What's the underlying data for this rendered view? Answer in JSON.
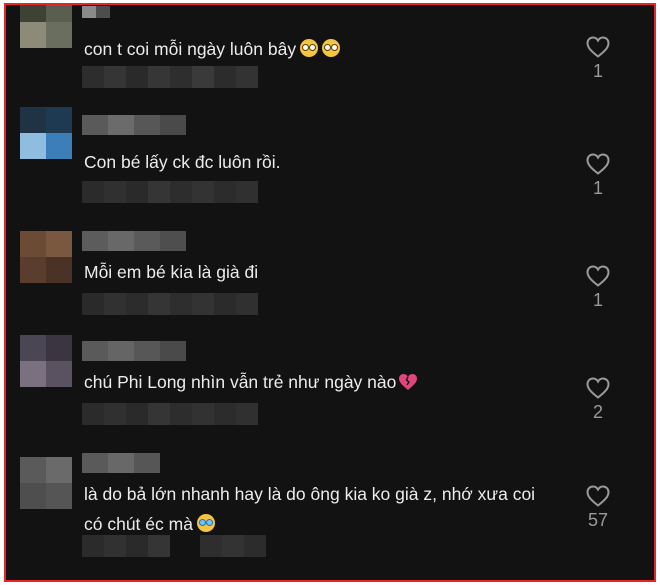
{
  "comments": [
    {
      "text": "con t coi mỗi ngày luôn bây",
      "likes": "1",
      "emoji": [
        "flushed-emoji",
        "flushed-emoji"
      ]
    },
    {
      "text": "Con bé lấy ck đc luôn rồi.",
      "likes": "1"
    },
    {
      "text": "Mỗi em bé kia là già đi",
      "likes": "1"
    },
    {
      "text": "chú Phi Long nhìn vẫn trẻ như ngày nào",
      "likes": "2",
      "emoji": [
        "broken-heart-emoji"
      ]
    },
    {
      "text": "là do bả lớn nhanh hay là do ông kia ko già z, nhớ xưa coi có chút éc mà",
      "likes": "57",
      "emoji": [
        "crying-emoji"
      ]
    }
  ],
  "colors": {
    "background": "#121212",
    "frame_border": "#e8232a",
    "text": "#ececec",
    "like_count": "#9a9a9a"
  },
  "icons": {
    "like": "heart-outline-icon"
  }
}
